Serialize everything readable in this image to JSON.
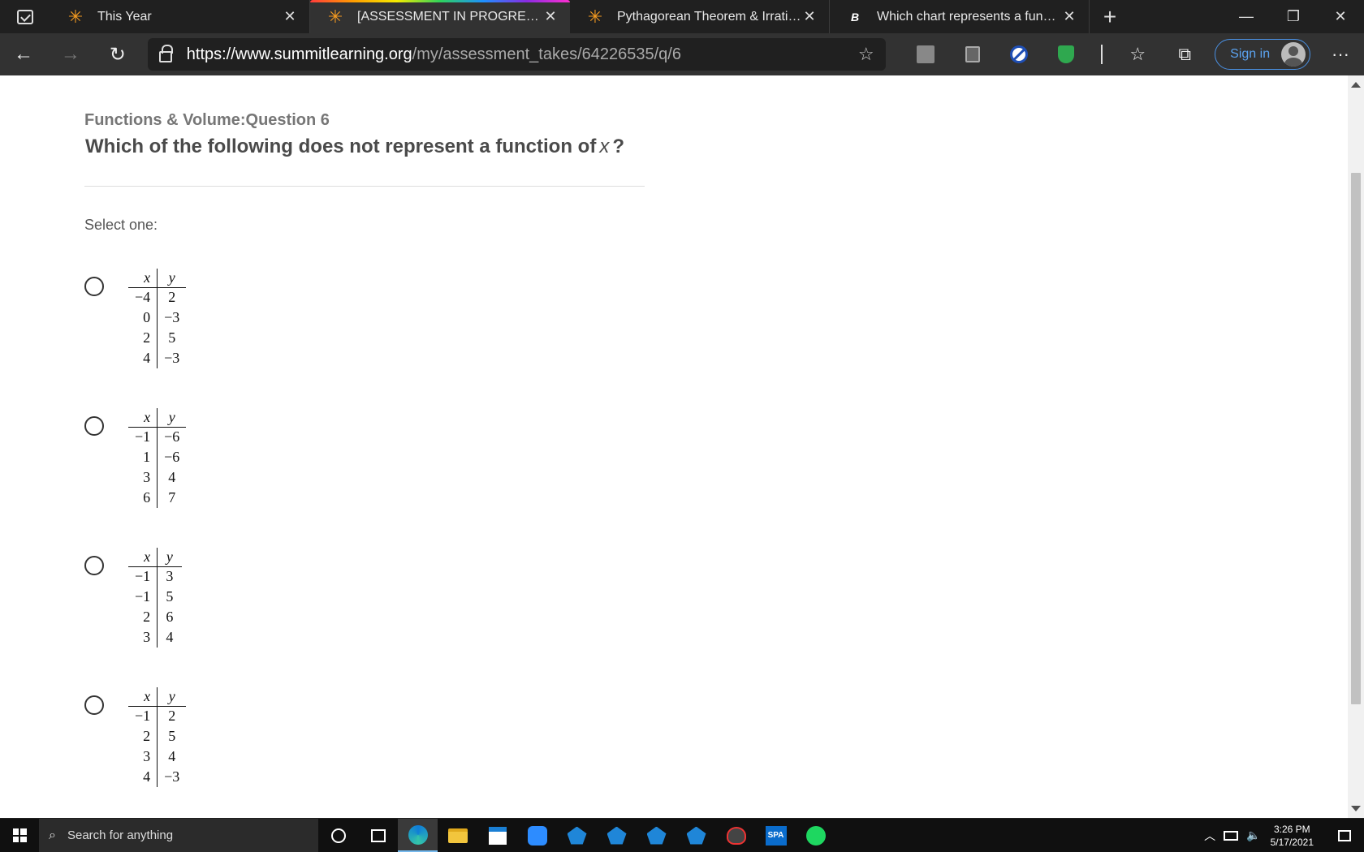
{
  "browser": {
    "tabs": [
      {
        "title": "This Year",
        "favicon": "asterisk-icon",
        "active": false
      },
      {
        "title": "[ASSESSMENT IN PROGRESS] Summit Learning",
        "favicon": "asterisk-icon",
        "active": true
      },
      {
        "title": "Pythagorean Theorem & Irrational Numbers",
        "favicon": "asterisk-icon",
        "active": false
      },
      {
        "title": "Which chart represents a function",
        "favicon": "brainly-icon",
        "active": false
      }
    ],
    "url_host": "https://www.summitlearning.org",
    "url_path": "/my/assessment_takes/64226535/q/6",
    "sign_in_label": "Sign in"
  },
  "question": {
    "header": "Functions & Volume:Question 6",
    "prompt_before": "Which of the following does not represent a function of",
    "prompt_var": "x",
    "prompt_after": "?",
    "select_label": "Select one:"
  },
  "options": [
    {
      "col_x": "x",
      "col_y": "y",
      "rows": [
        [
          "−4",
          "2"
        ],
        [
          "0",
          "−3"
        ],
        [
          "2",
          "5"
        ],
        [
          "4",
          "−3"
        ]
      ]
    },
    {
      "col_x": "x",
      "col_y": "y",
      "rows": [
        [
          "−1",
          "−6"
        ],
        [
          "1",
          "−6"
        ],
        [
          "3",
          "4"
        ],
        [
          "6",
          "7"
        ]
      ]
    },
    {
      "col_x": "x",
      "col_y": "y",
      "rows": [
        [
          "−1",
          "3"
        ],
        [
          "−1",
          "5"
        ],
        [
          "2",
          "6"
        ],
        [
          "3",
          "4"
        ]
      ]
    },
    {
      "col_x": "x",
      "col_y": "y",
      "rows": [
        [
          "−1",
          "2"
        ],
        [
          "2",
          "5"
        ],
        [
          "3",
          "4"
        ],
        [
          "4",
          "−3"
        ]
      ]
    }
  ],
  "taskbar": {
    "search_placeholder": "Search for anything",
    "time": "3:26 PM",
    "date": "5/17/2021",
    "spa_label": "SPA"
  }
}
